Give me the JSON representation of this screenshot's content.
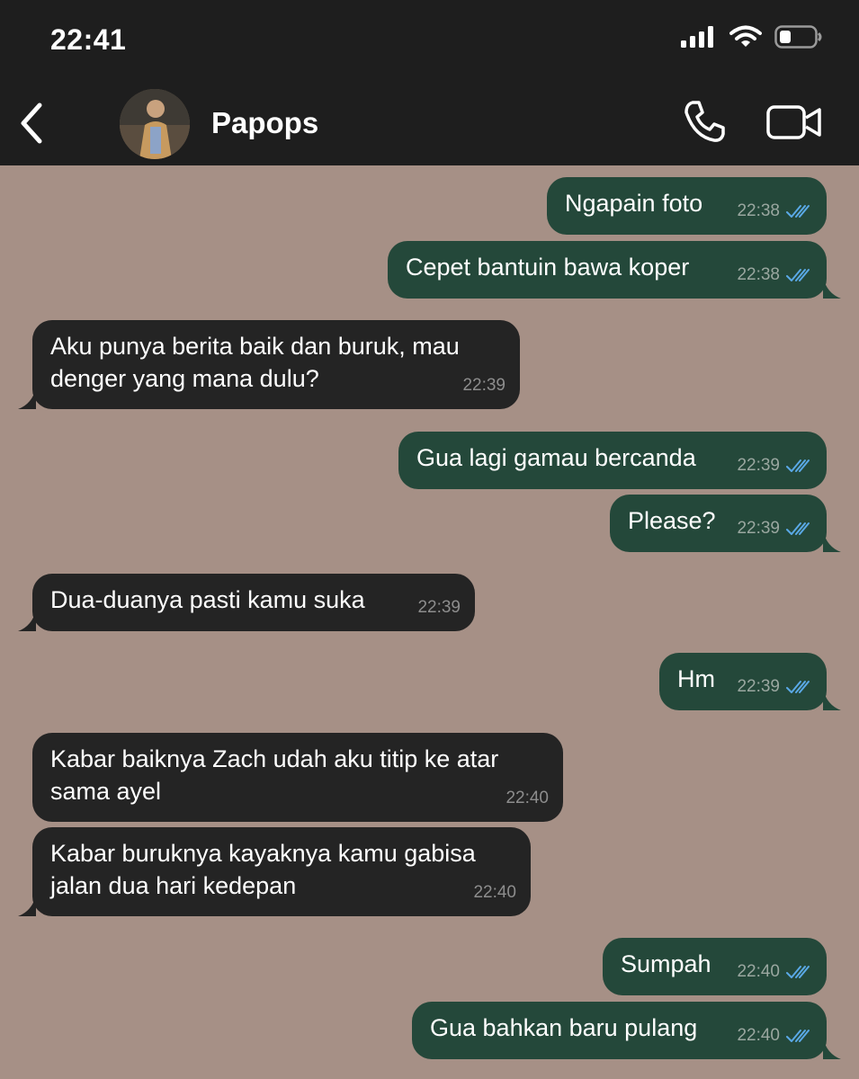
{
  "status_bar": {
    "time": "22:41"
  },
  "header": {
    "contact_name": "Papops"
  },
  "messages": [
    {
      "dir": "out",
      "text": "Ngapain foto",
      "time": "22:38"
    },
    {
      "dir": "out",
      "text": "Cepet bantuin bawa koper",
      "time": "22:38"
    },
    {
      "dir": "in",
      "text": "Aku punya berita baik dan buruk, mau denger yang mana dulu?",
      "time": "22:39"
    },
    {
      "dir": "out",
      "text": "Gua lagi gamau bercanda",
      "time": "22:39"
    },
    {
      "dir": "out",
      "text": "Please?",
      "time": "22:39"
    },
    {
      "dir": "in",
      "text": "Dua-duanya pasti kamu suka",
      "time": "22:39"
    },
    {
      "dir": "out",
      "text": "Hm",
      "time": "22:39"
    },
    {
      "dir": "in",
      "text": "Kabar baiknya Zach udah aku titip ke atar sama ayel",
      "time": "22:40"
    },
    {
      "dir": "in",
      "text": "Kabar buruknya kayaknya kamu gabisa jalan dua hari kedepan",
      "time": "22:40"
    },
    {
      "dir": "out",
      "text": "Sumpah",
      "time": "22:40"
    },
    {
      "dir": "out",
      "text": "Gua bahkan baru pulang",
      "time": "22:40"
    }
  ],
  "colors": {
    "chat_background": "#a69086",
    "outgoing_bubble": "#24483a",
    "incoming_bubble": "#242424",
    "read_ticks": "#5aa9e6"
  },
  "icons": [
    "back-chevron-icon",
    "phone-icon",
    "video-camera-icon",
    "signal-icon",
    "wifi-icon",
    "battery-icon",
    "double-check-icon"
  ]
}
